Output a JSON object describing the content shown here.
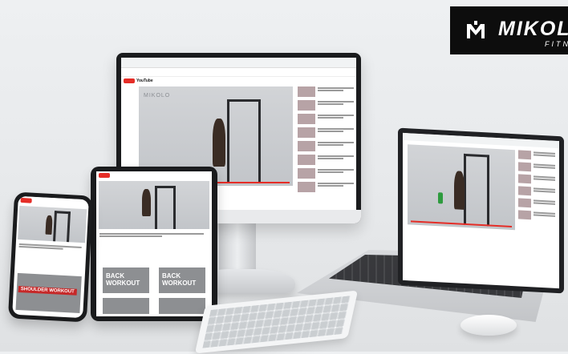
{
  "brand": {
    "name": "MIKOL",
    "subtitle": "FITN",
    "logo_icon": "mikolo-crest-icon"
  },
  "monitor": {
    "video_watermark": "MIKOLO",
    "site_logo_text": "YouTube"
  },
  "tablet": {
    "thumb_banner_1": "BACK WORKOUT",
    "thumb_banner_2": "BACK WORKOUT"
  },
  "phone": {
    "thumb_banner": "SHOULDER WORKOUT"
  },
  "colors": {
    "logo_bg": "#0d0d0d",
    "youtube_red": "#e52d27",
    "background": "#e8eaec"
  }
}
